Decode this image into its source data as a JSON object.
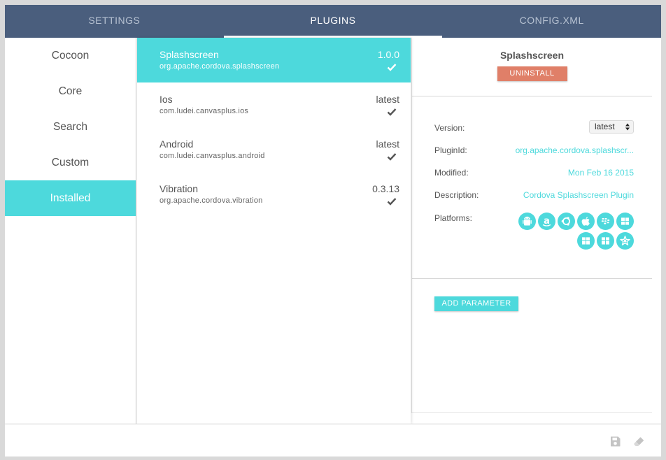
{
  "tabs": [
    {
      "label": "SETTINGS",
      "active": false
    },
    {
      "label": "PLUGINS",
      "active": true
    },
    {
      "label": "CONFIG.XML",
      "active": false
    }
  ],
  "sidebar": {
    "items": [
      {
        "label": "Cocoon"
      },
      {
        "label": "Core"
      },
      {
        "label": "Search"
      },
      {
        "label": "Custom"
      },
      {
        "label": "Installed",
        "active": true
      }
    ]
  },
  "plugins": [
    {
      "name": "Splashscreen",
      "id": "org.apache.cordova.splashscreen",
      "version": "1.0.0",
      "installed": true,
      "selected": true
    },
    {
      "name": "Ios",
      "id": "com.ludei.canvasplus.ios",
      "version": "latest",
      "installed": true
    },
    {
      "name": "Android",
      "id": "com.ludei.canvasplus.android",
      "version": "latest",
      "installed": true
    },
    {
      "name": "Vibration",
      "id": "org.apache.cordova.vibration",
      "version": "0.3.13",
      "installed": true
    }
  ],
  "detail": {
    "title": "Splashscreen",
    "uninstall_label": "UNINSTALL",
    "version_label": "Version:",
    "version_value": "latest",
    "pluginid_label": "PluginId:",
    "pluginid_value": "org.apache.cordova.splashscr...",
    "modified_label": "Modified:",
    "modified_value": "Mon Feb 16 2015",
    "description_label": "Description:",
    "description_value": "Cordova Splashscreen Plugin",
    "platforms_label": "Platforms:",
    "platform_icons": [
      "android-icon",
      "amazon-icon",
      "ubuntu-icon",
      "apple-icon",
      "blackberry-icon",
      "windows-icon",
      "windows8-icon",
      "windows-phone-icon",
      "firefoxos-icon"
    ],
    "add_parameter_label": "ADD PARAMETER"
  },
  "footer": {
    "icons": [
      "save-icon",
      "eraser-icon"
    ]
  },
  "colors": {
    "header": "#4a5e7d",
    "accent": "#4dd9dc",
    "danger": "#e07f68"
  }
}
